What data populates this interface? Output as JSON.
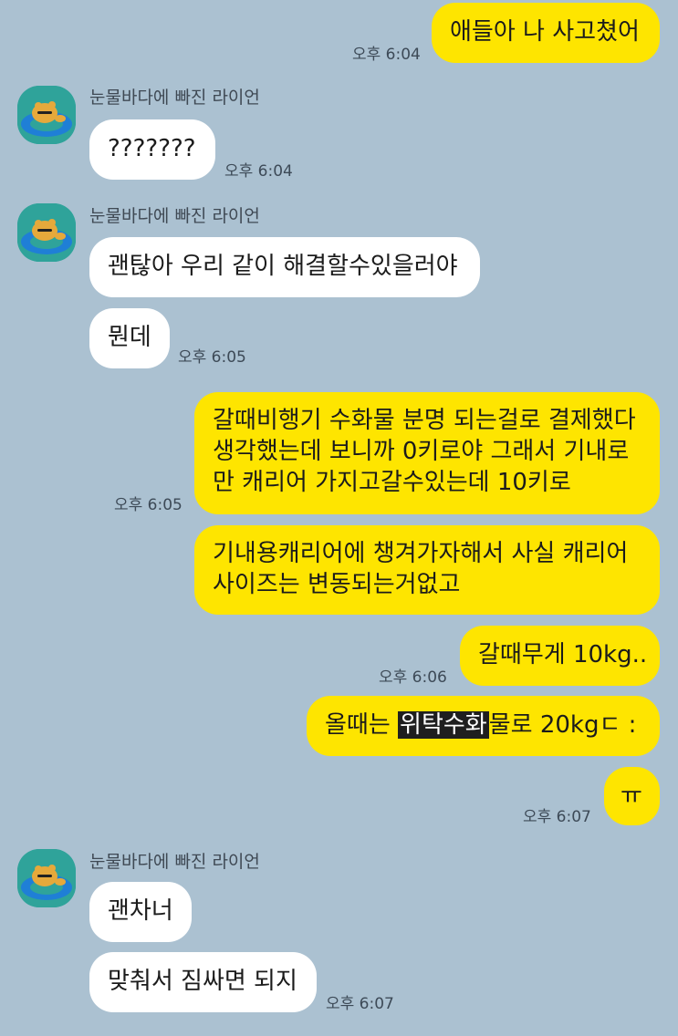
{
  "chat": {
    "sender_name": "눈물바다에 빠진 라이언",
    "avatar_icon": "ryan-in-tube-avatar-icon",
    "colors": {
      "background": "#abc1d1",
      "my_bubble": "#fee500",
      "their_bubble": "#ffffff"
    },
    "messages": [
      {
        "from": "me",
        "text": "애들아 나 사고쳤어",
        "time": "오후 6:04"
      },
      {
        "from": "them",
        "text": "???????",
        "time": "오후 6:04"
      },
      {
        "from": "them",
        "text": "괜탆아 우리 같이 해결할수있을러야"
      },
      {
        "from": "them",
        "text": "뭔데",
        "time": "오후 6:05"
      },
      {
        "from": "me",
        "lines": [
          "갈때비행기 수화물 분명 되는걸로 결제했다",
          "생각했는데 보니까 0키로야 그래서 기내로",
          "만 캐리어 가지고갈수있는데 10키로"
        ],
        "time": "오후 6:05"
      },
      {
        "from": "me",
        "lines": [
          "기내용캐리어에 챙겨가자해서 사실 캐리어",
          "사이즈는 변동되는거없고"
        ]
      },
      {
        "from": "me",
        "text": "갈때무게 10kg..",
        "time": "오후 6:06"
      },
      {
        "from": "me",
        "text_before": "올때는 ",
        "text_highlight": "위탁수화",
        "text_after": "물로 20kgㄷ :"
      },
      {
        "from": "me",
        "text": "ㅠ",
        "time": "오후 6:07"
      },
      {
        "from": "them",
        "text": "괜차너"
      },
      {
        "from": "them",
        "text": "맞춰서 짐싸면 되지",
        "time": "오후 6:07"
      }
    ]
  }
}
